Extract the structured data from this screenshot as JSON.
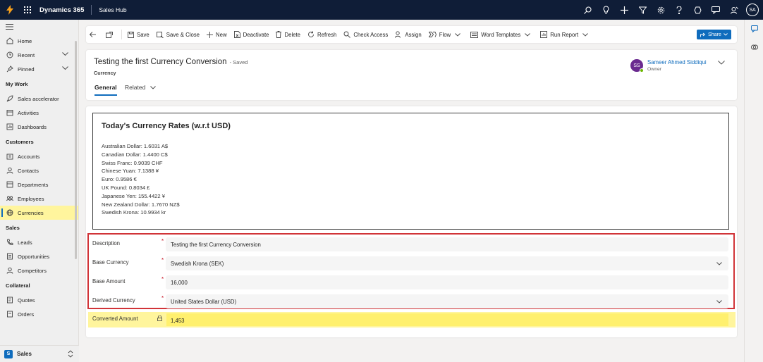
{
  "topbar": {
    "brand": "Dynamics 365",
    "app_name": "Sales Hub",
    "user_initials": "SA",
    "icons": [
      "search-icon",
      "lightbulb-icon",
      "plus-icon",
      "filter-icon",
      "gear-icon",
      "help-icon",
      "copilot-icon",
      "chat-icon",
      "assist-icon"
    ]
  },
  "sidebar": {
    "top_items": [
      {
        "label": "Home",
        "icon": "home-icon"
      },
      {
        "label": "Recent",
        "icon": "clock-icon",
        "has_chevron": true
      },
      {
        "label": "Pinned",
        "icon": "pin-icon",
        "has_chevron": true
      }
    ],
    "sections": [
      {
        "title": "My Work",
        "items": [
          {
            "label": "Sales accelerator",
            "icon": "rocket-icon"
          },
          {
            "label": "Activities",
            "icon": "activities-icon"
          },
          {
            "label": "Dashboards",
            "icon": "dashboard-icon"
          }
        ]
      },
      {
        "title": "Customers",
        "items": [
          {
            "label": "Accounts",
            "icon": "accounts-icon"
          },
          {
            "label": "Contacts",
            "icon": "contact-icon"
          },
          {
            "label": "Departments",
            "icon": "departments-icon"
          },
          {
            "label": "Employees",
            "icon": "employees-icon"
          },
          {
            "label": "Currencies",
            "icon": "globe-icon",
            "active": true
          }
        ]
      },
      {
        "title": "Sales",
        "items": [
          {
            "label": "Leads",
            "icon": "phone-icon"
          },
          {
            "label": "Opportunities",
            "icon": "opportunity-icon"
          },
          {
            "label": "Competitors",
            "icon": "competitor-icon"
          }
        ]
      },
      {
        "title": "Collateral",
        "items": [
          {
            "label": "Quotes",
            "icon": "quote-icon"
          },
          {
            "label": "Orders",
            "icon": "order-icon"
          }
        ]
      }
    ],
    "area": {
      "badge": "S",
      "label": "Sales"
    }
  },
  "commands": {
    "back": "",
    "save": "Save",
    "save_close": "Save & Close",
    "new": "New",
    "deactivate": "Deactivate",
    "delete": "Delete",
    "refresh": "Refresh",
    "check_access": "Check Access",
    "assign": "Assign",
    "flow": "Flow",
    "word_templates": "Word Templates",
    "run_report": "Run Report",
    "share": "Share"
  },
  "header": {
    "title": "Testing the first Currency Conversion",
    "status": "- Saved",
    "entity": "Currency",
    "tabs": {
      "general": "General",
      "related": "Related"
    },
    "owner": {
      "initials": "SS",
      "name": "Sameer Ahmed Siddiqui",
      "role": "Owner"
    }
  },
  "rates": {
    "title": "Today's Currency Rates (w.r.t USD)",
    "lines": [
      "Australian Dollar: 1.6031 A$",
      "Canadian Dollar: 1.4400 C$",
      "Swiss Franc: 0.9039 CHF",
      "Chinese Yuan: 7.1388 ¥",
      "Euro: 0.9586 €",
      "UK Pound: 0.8034 £",
      "Japanese Yen: 155.4422 ¥",
      "New Zealand Dollar: 1.7670 NZ$",
      "Swedish Krona: 10.9934 kr"
    ]
  },
  "fields": {
    "description": {
      "label": "Description",
      "value": "Testing the first Currency Conversion"
    },
    "base_currency": {
      "label": "Base Currency",
      "value": "Swedish Krona (SEK)"
    },
    "base_amount": {
      "label": "Base Amount",
      "value": "16,000"
    },
    "derived_currency": {
      "label": "Derived Currency",
      "value": "United States Dollar (USD)"
    },
    "converted_amount": {
      "label": "Converted Amount",
      "value": "1,453"
    },
    "required_marker": "*"
  },
  "colors": {
    "topbar": "#0f1d37",
    "accent": "#0f6cbd",
    "highlight": "#fff59d",
    "outline_red": "#d13438"
  }
}
